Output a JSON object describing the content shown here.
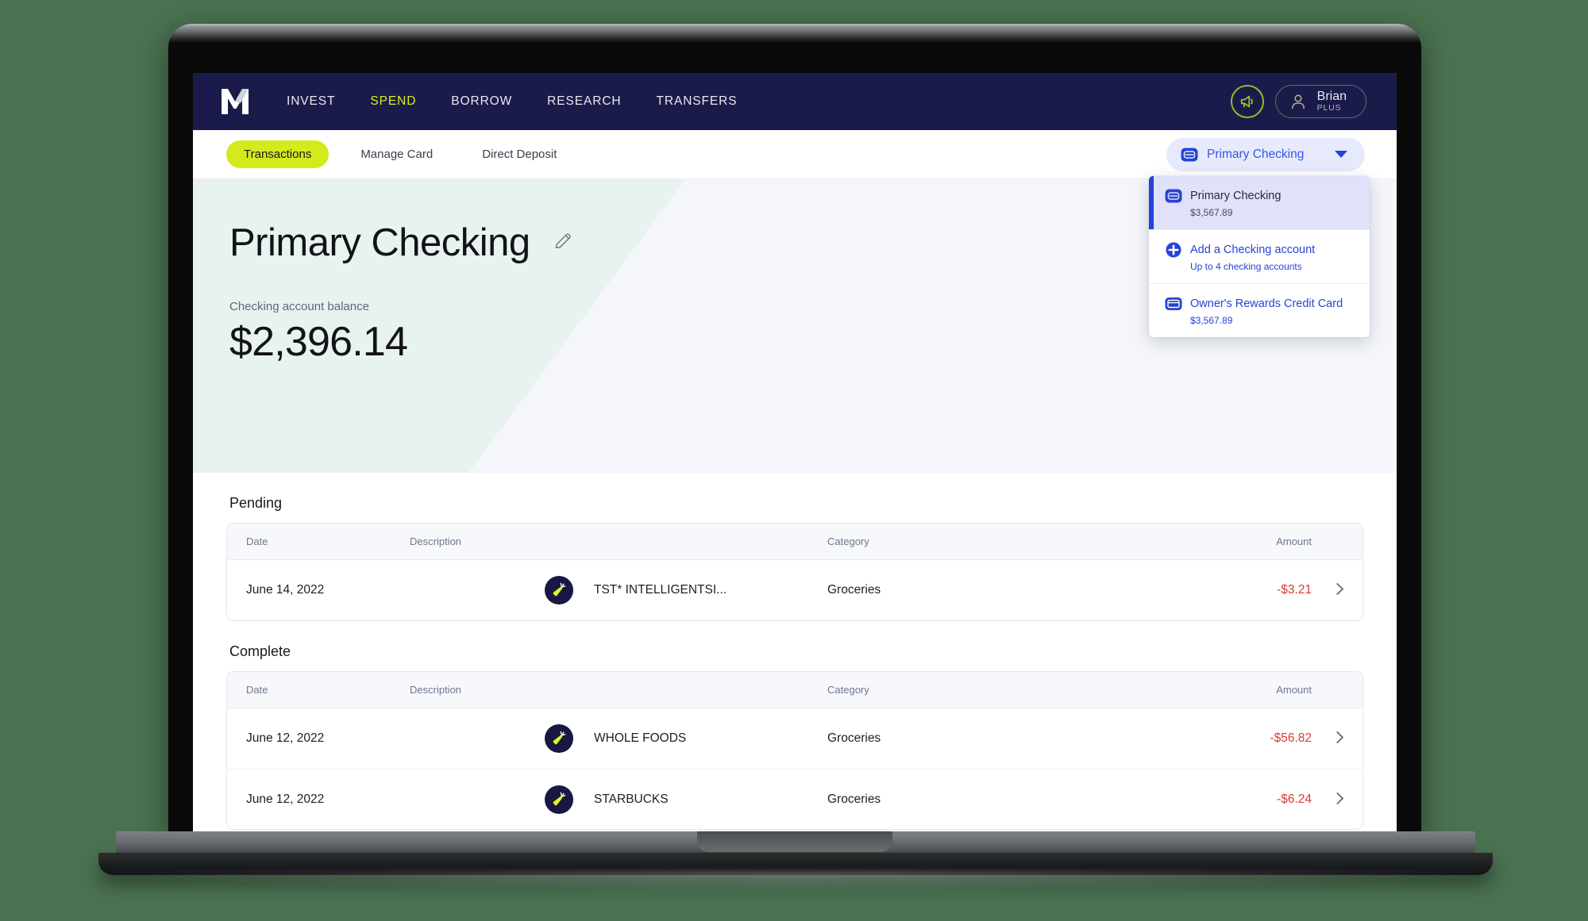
{
  "brand": {
    "logo_icon": "m1-logo-icon",
    "accent_lime": "#d9f21d",
    "nav_bg": "#1b1b4b",
    "link_blue": "#2742d6",
    "negative_red": "#d93a35",
    "hero_green": "#e8f2ee",
    "page_bg": "#4a7150"
  },
  "topnav": {
    "links": [
      {
        "label": "INVEST",
        "active": false
      },
      {
        "label": "SPEND",
        "active": true
      },
      {
        "label": "BORROW",
        "active": false
      },
      {
        "label": "RESEARCH",
        "active": false
      },
      {
        "label": "TRANSFERS",
        "active": false
      }
    ],
    "announce_icon": "megaphone-icon",
    "profile": {
      "avatar_icon": "person-icon",
      "name": "Brian",
      "tier": "PLUS"
    }
  },
  "subnav": {
    "tabs": [
      {
        "label": "Transactions",
        "active": true
      },
      {
        "label": "Manage Card",
        "active": false
      },
      {
        "label": "Direct Deposit",
        "active": false
      }
    ]
  },
  "account_selector": {
    "icon": "card-icon",
    "selected_label": "Primary Checking",
    "chevron_icon": "chevron-down-icon",
    "menu_open": true,
    "menu_items": [
      {
        "icon": "card-icon",
        "title": "Primary Checking",
        "subtitle": "$3,567.89",
        "selected": true,
        "is_link": false
      },
      {
        "icon": "plus-circle-icon",
        "title": "Add a Checking account",
        "subtitle": "Up to 4 checking accounts",
        "selected": false,
        "is_link": true
      },
      {
        "icon": "credit-card-icon",
        "title": "Owner's Rewards Credit Card",
        "subtitle": "$3,567.89",
        "selected": false,
        "is_link": true
      }
    ]
  },
  "hero": {
    "title": "Primary Checking",
    "edit_icon": "pencil-icon",
    "balance_label": "Checking account balance",
    "balance": "$2,396.14"
  },
  "transactions": {
    "columns": {
      "date": "Date",
      "description": "Description",
      "category": "Category",
      "amount": "Amount"
    },
    "sections": [
      {
        "title": "Pending",
        "rows": [
          {
            "date": "June 14, 2022",
            "icon": "carrot-icon",
            "description": "TST* INTELLIGENTSI...",
            "category": "Groceries",
            "amount": "-$3.21",
            "chevron": "chevron-right-icon"
          }
        ]
      },
      {
        "title": "Complete",
        "rows": [
          {
            "date": "June 12, 2022",
            "icon": "carrot-icon",
            "description": "WHOLE FOODS",
            "category": "Groceries",
            "amount": "-$56.82",
            "chevron": "chevron-right-icon"
          },
          {
            "date": "June 12, 2022",
            "icon": "carrot-icon",
            "description": "STARBUCKS",
            "category": "Groceries",
            "amount": "-$6.24",
            "chevron": "chevron-right-icon"
          }
        ]
      }
    ]
  }
}
